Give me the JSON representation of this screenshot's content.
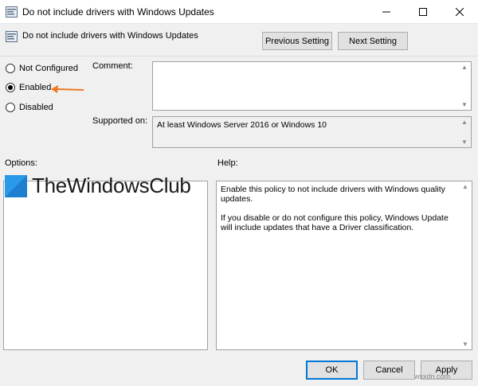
{
  "window": {
    "title": "Do not include drivers with Windows Updates",
    "controls": {
      "minimize": "—",
      "maximize": "☐",
      "close": "✕"
    }
  },
  "header": {
    "policy_title": "Do not include drivers with Windows Updates",
    "previous_label": "Previous Setting",
    "next_label": "Next Setting"
  },
  "state": {
    "options": [
      {
        "label": "Not Configured",
        "checked": false
      },
      {
        "label": "Enabled",
        "checked": true
      },
      {
        "label": "Disabled",
        "checked": false
      }
    ]
  },
  "comment": {
    "label": "Comment:",
    "value": ""
  },
  "supported": {
    "label": "Supported on:",
    "value": "At least Windows Server 2016 or Windows 10"
  },
  "options_panel": {
    "label": "Options:"
  },
  "help_panel": {
    "label": "Help:",
    "paragraphs": [
      "Enable this policy to not include drivers with Windows quality updates.",
      "If you disable or do not configure this policy, Windows Update will include updates that have a Driver classification."
    ]
  },
  "footer": {
    "ok_label": "OK",
    "cancel_label": "Cancel",
    "apply_label": "Apply"
  },
  "watermark": {
    "logo_text": "TheWindowsClub",
    "site": "wsxdn.com"
  },
  "colors": {
    "accent": "#0078d7",
    "arrow": "#f07820",
    "logo_blue": "#1e7fd0"
  }
}
